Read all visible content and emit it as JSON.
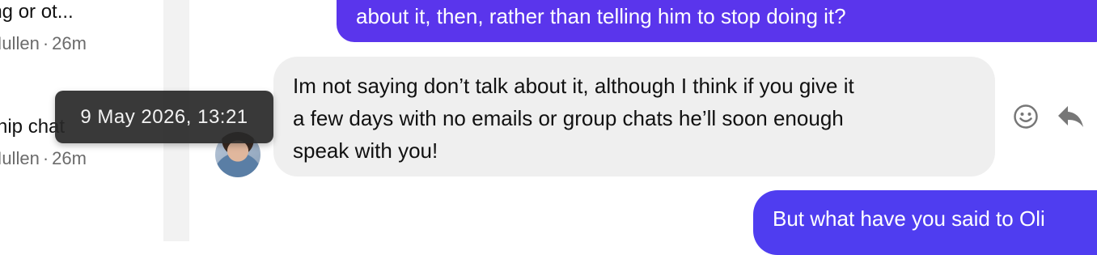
{
  "sidebar": {
    "conversations": [
      {
        "title": "ing or ot...",
        "author": "Mullen",
        "time": "26m"
      },
      {
        "title": "ship chat",
        "author": "Mullen",
        "time": "26m"
      }
    ],
    "meta_separator": "·"
  },
  "tooltip": {
    "text": "9 May 2026, 13:21"
  },
  "messages": {
    "top_outgoing": "about it, then, rather than telling him to stop doing it?",
    "incoming_lines": [
      "Im not saying don’t talk about it, although I think if you give it",
      "a few days with no emails or group chats he’ll soon enough",
      "speak with you!"
    ],
    "bottom_outgoing": "But what have you said to Oli"
  },
  "actions": {
    "emoji_icon": "smiley-icon",
    "reply_icon": "reply-icon"
  },
  "colors": {
    "outgoing_bubble": "#5a35ec",
    "incoming_bubble": "#efefef"
  }
}
